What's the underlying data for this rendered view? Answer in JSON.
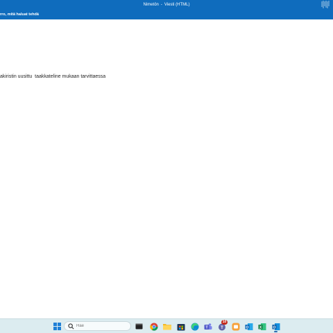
{
  "window": {
    "title_left": "Nimetön",
    "title_sep": "-",
    "title_right": "Viesti (HTML)"
  },
  "ribbon": {
    "tell_me": "rro, mitä haluat tehdä"
  },
  "message": {
    "body_line": "akiristin uusittu  taakkateline mukaan tarvittaessa"
  },
  "taskbar": {
    "search_placeholder": "Hae",
    "notification_badge": "10",
    "icons": [
      "windows-start-icon",
      "search-icon",
      "terminal-icon",
      "chrome-icon",
      "file-explorer-icon",
      "store-icon",
      "edge-icon",
      "teams-icon",
      "teams-notification-icon",
      "photos-icon",
      "outlook-icon",
      "excel-icon",
      "outlook-new-icon"
    ]
  },
  "colors": {
    "accent": "#0f6cbd",
    "taskbar": "#dcecf0"
  }
}
